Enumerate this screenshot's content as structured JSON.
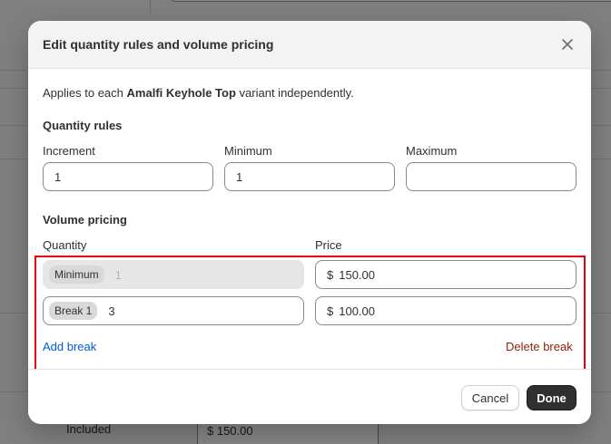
{
  "background": {
    "included_label": "Included",
    "included_price": "$  150.00"
  },
  "modal": {
    "title": "Edit quantity rules and volume pricing",
    "applies_prefix": "Applies to each",
    "product_name": "Amalfi Keyhole Top",
    "applies_suffix": "variant independently.",
    "quantity_rules": {
      "heading": "Quantity rules",
      "increment_label": "Increment",
      "increment_value": "1",
      "minimum_label": "Minimum",
      "minimum_value": "1",
      "maximum_label": "Maximum",
      "maximum_value": ""
    },
    "volume_pricing": {
      "heading": "Volume pricing",
      "quantity_header": "Quantity",
      "price_header": "Price",
      "rows": [
        {
          "chip": "Minimum",
          "quantity": "1",
          "currency": "$",
          "price": "150.00"
        },
        {
          "chip": "Break 1",
          "quantity": "3",
          "currency": "$",
          "price": "100.00"
        }
      ],
      "add_break": "Add break",
      "delete_break": "Delete break"
    },
    "footer": {
      "cancel": "Cancel",
      "done": "Done"
    }
  },
  "colors": {
    "highlight_border": "#e3000f",
    "link": "#005bd3",
    "critical_link": "#8e1f0b",
    "primary_button": "#303030"
  }
}
